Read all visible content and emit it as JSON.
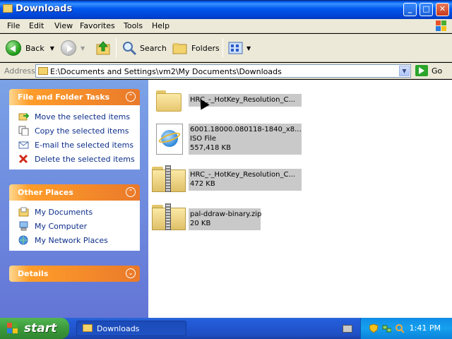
{
  "window": {
    "title": "Downloads"
  },
  "menu": [
    "File",
    "Edit",
    "View",
    "Favorites",
    "Tools",
    "Help"
  ],
  "toolbar": {
    "back_label": "Back",
    "search_label": "Search",
    "folders_label": "Folders"
  },
  "address": {
    "label": "Address",
    "path": "E:\\Documents and Settings\\vm2\\My Documents\\Downloads",
    "go_label": "Go"
  },
  "tasks": {
    "header": "File and Folder Tasks",
    "items": [
      "Move the selected items",
      "Copy the selected items",
      "E-mail the selected items",
      "Delete the selected items"
    ]
  },
  "other_places": {
    "header": "Other Places",
    "items": [
      "My Documents",
      "My Computer",
      "My Network Places"
    ]
  },
  "details": {
    "header": "Details"
  },
  "files": [
    {
      "name": "HRC_-_HotKey_Resolution_C...",
      "type": "",
      "size": "",
      "icon": "folder-icon"
    },
    {
      "name": "6001.18000.080118-1840_x8...",
      "type": "ISO File",
      "size": "557,418 KB",
      "icon": "iso-file-icon"
    },
    {
      "name": "HRC_-_HotKey_Resolution_C...",
      "type": "",
      "size": "472 KB",
      "icon": "zip-icon"
    },
    {
      "name": "pal-ddraw-binary.zip",
      "type": "",
      "size": "20 KB",
      "icon": "zip-icon"
    }
  ],
  "taskbar": {
    "start_label": "start",
    "task_label": "Downloads",
    "clock": "1:41 PM"
  }
}
